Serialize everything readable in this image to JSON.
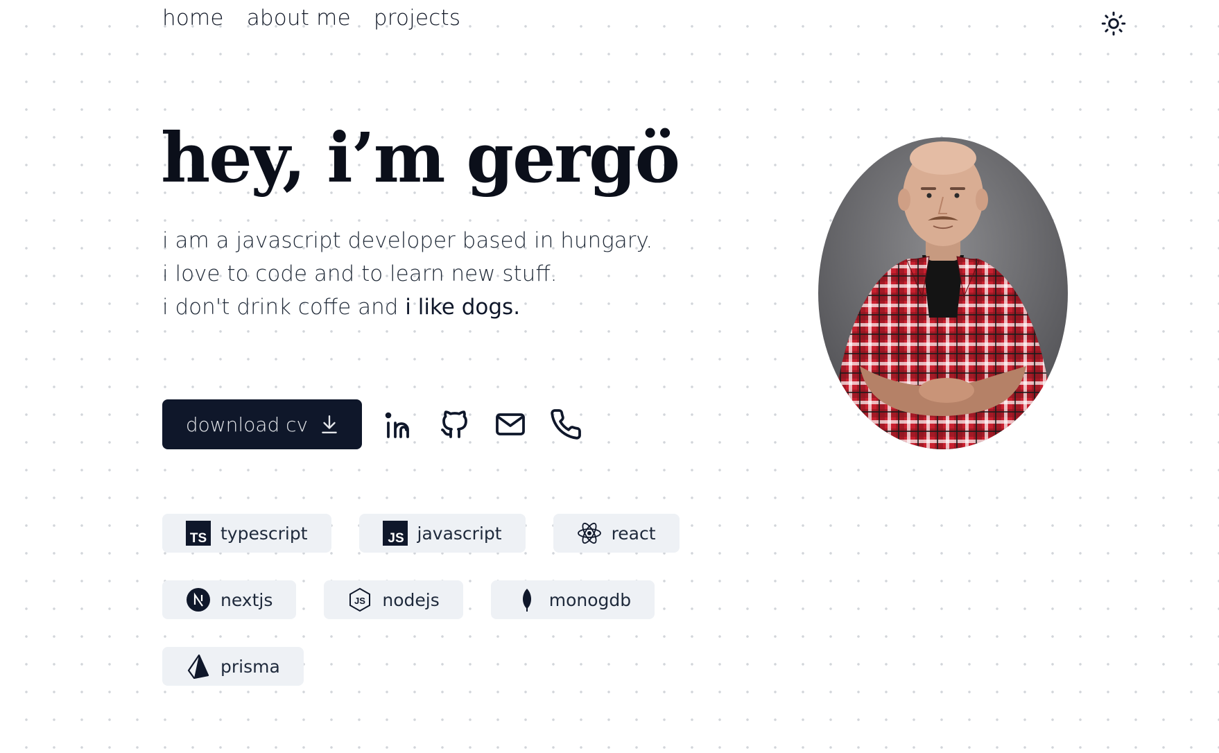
{
  "nav": {
    "items": [
      {
        "label": "home"
      },
      {
        "label": "about me"
      },
      {
        "label": "projects"
      }
    ],
    "theme_toggle_icon": "sun-icon"
  },
  "hero": {
    "title": "hey, i’m gergö",
    "intro": {
      "line1": "i am a javascript developer based in hungary.",
      "line2": "i love to code and to learn new stuff.",
      "line3_prefix": "i don't drink coffe and ",
      "line3_emphasis": "i like dogs."
    }
  },
  "actions": {
    "download_label": "download cv",
    "download_icon": "download-icon",
    "social": [
      "linkedin-icon",
      "github-icon",
      "mail-icon",
      "phone-icon"
    ]
  },
  "profile": {
    "photo": "portrait of man in red plaid shirt"
  },
  "skills": [
    {
      "label": "typescript",
      "icon": "typescript-icon"
    },
    {
      "label": "javascript",
      "icon": "javascript-icon"
    },
    {
      "label": "react",
      "icon": "react-icon"
    },
    {
      "label": "nextjs",
      "icon": "nextjs-icon"
    },
    {
      "label": "nodejs",
      "icon": "nodejs-icon"
    },
    {
      "label": "monogdb",
      "icon": "mongodb-icon"
    },
    {
      "label": "prisma",
      "icon": "prisma-icon"
    }
  ],
  "colors": {
    "primary_dark": "#0f172a",
    "chip_background": "#eef1f5",
    "dot_grid": "#d2d5da"
  }
}
